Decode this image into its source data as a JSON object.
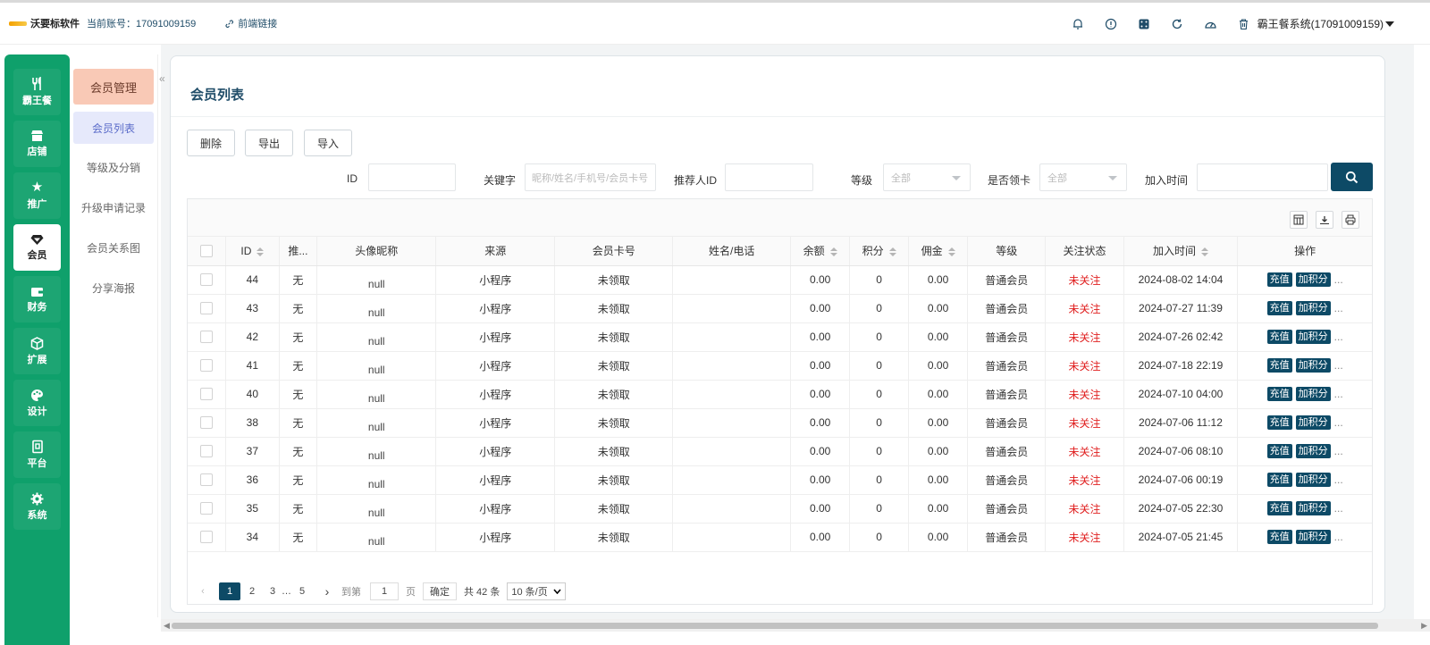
{
  "topbar": {
    "brand": "沃要标软件",
    "account": "当前账号：17091009159",
    "front_link": "前端链接",
    "icons": [
      "bell-icon",
      "info-icon",
      "dice-icon",
      "refresh-icon",
      "dashboard-icon",
      "trash-icon"
    ],
    "user_system": "霸王餐系统(17091009159)"
  },
  "sidebar": {
    "items": [
      {
        "label": "霸王餐",
        "icon": "utensils-icon"
      },
      {
        "label": "店铺",
        "icon": "store-icon"
      },
      {
        "label": "推广",
        "icon": "star-icon"
      },
      {
        "label": "会员",
        "icon": "diamond-icon",
        "active": true
      },
      {
        "label": "财务",
        "icon": "wallet-icon"
      },
      {
        "label": "扩展",
        "icon": "cube-icon"
      },
      {
        "label": "设计",
        "icon": "palette-icon"
      },
      {
        "label": "平台",
        "icon": "platform-icon"
      },
      {
        "label": "系统",
        "icon": "gear-icon"
      }
    ]
  },
  "submenu": {
    "head": "会员管理",
    "items": [
      "会员列表",
      "等级及分销",
      "升级申请记录",
      "会员关系图",
      "分享海报"
    ]
  },
  "main": {
    "title": "会员列表",
    "buttons": {
      "delete": "删除",
      "export": "导出",
      "import": "导入"
    },
    "filters": {
      "id_label": "ID",
      "keyword_label": "关键字",
      "keyword_placeholder": "昵称/姓名/手机号/会员卡号",
      "referrer_label": "推荐人ID",
      "level_label": "等级",
      "level_value": "全部",
      "card_label": "是否领卡",
      "card_value": "全部",
      "join_time_label": "加入时间"
    },
    "table": {
      "columns": [
        "ID",
        "推...",
        "头像昵称",
        "来源",
        "会员卡号",
        "姓名/电话",
        "余额",
        "积分",
        "佣金",
        "等级",
        "关注状态",
        "加入时间",
        "操作"
      ],
      "op_labels": {
        "recharge": "充值",
        "add_points": "加积分",
        "more": "..."
      },
      "rows": [
        {
          "id": "44",
          "ref": "无",
          "nick": "null",
          "source": "小程序",
          "card": "未领取",
          "name": "",
          "balance": "0.00",
          "points": "0",
          "commission": "0.00",
          "level": "普通会员",
          "follow": "未关注",
          "time": "2024-08-02 14:04"
        },
        {
          "id": "43",
          "ref": "无",
          "nick": "null",
          "source": "小程序",
          "card": "未领取",
          "name": "",
          "balance": "0.00",
          "points": "0",
          "commission": "0.00",
          "level": "普通会员",
          "follow": "未关注",
          "time": "2024-07-27 11:39"
        },
        {
          "id": "42",
          "ref": "无",
          "nick": "null",
          "source": "小程序",
          "card": "未领取",
          "name": "",
          "balance": "0.00",
          "points": "0",
          "commission": "0.00",
          "level": "普通会员",
          "follow": "未关注",
          "time": "2024-07-26 02:42"
        },
        {
          "id": "41",
          "ref": "无",
          "nick": "null",
          "source": "小程序",
          "card": "未领取",
          "name": "",
          "balance": "0.00",
          "points": "0",
          "commission": "0.00",
          "level": "普通会员",
          "follow": "未关注",
          "time": "2024-07-18 22:19"
        },
        {
          "id": "40",
          "ref": "无",
          "nick": "null",
          "source": "小程序",
          "card": "未领取",
          "name": "",
          "balance": "0.00",
          "points": "0",
          "commission": "0.00",
          "level": "普通会员",
          "follow": "未关注",
          "time": "2024-07-10 04:00"
        },
        {
          "id": "38",
          "ref": "无",
          "nick": "null",
          "source": "小程序",
          "card": "未领取",
          "name": "",
          "balance": "0.00",
          "points": "0",
          "commission": "0.00",
          "level": "普通会员",
          "follow": "未关注",
          "time": "2024-07-06 11:12"
        },
        {
          "id": "37",
          "ref": "无",
          "nick": "null",
          "source": "小程序",
          "card": "未领取",
          "name": "",
          "balance": "0.00",
          "points": "0",
          "commission": "0.00",
          "level": "普通会员",
          "follow": "未关注",
          "time": "2024-07-06 08:10"
        },
        {
          "id": "36",
          "ref": "无",
          "nick": "null",
          "source": "小程序",
          "card": "未领取",
          "name": "",
          "balance": "0.00",
          "points": "0",
          "commission": "0.00",
          "level": "普通会员",
          "follow": "未关注",
          "time": "2024-07-06 00:19"
        },
        {
          "id": "35",
          "ref": "无",
          "nick": "null",
          "source": "小程序",
          "card": "未领取",
          "name": "",
          "balance": "0.00",
          "points": "0",
          "commission": "0.00",
          "level": "普通会员",
          "follow": "未关注",
          "time": "2024-07-05 22:30"
        },
        {
          "id": "34",
          "ref": "无",
          "nick": "null",
          "source": "小程序",
          "card": "未领取",
          "name": "",
          "balance": "0.00",
          "points": "0",
          "commission": "0.00",
          "level": "普通会员",
          "follow": "未关注",
          "time": "2024-07-05 21:45"
        }
      ]
    },
    "pagination": {
      "pages": [
        "1",
        "2",
        "3",
        "…",
        "5"
      ],
      "current": "1",
      "goto_label": "到第",
      "goto_value": "1",
      "page_unit": "页",
      "confirm": "确定",
      "total": "共 42 条",
      "page_size": "10 条/页"
    }
  },
  "colors": {
    "sidebar_green": "#0fa06b",
    "primary_navy": "#0d4a66",
    "unfollowed_red": "#e02020",
    "submenu_head": "#f9c9b6"
  }
}
